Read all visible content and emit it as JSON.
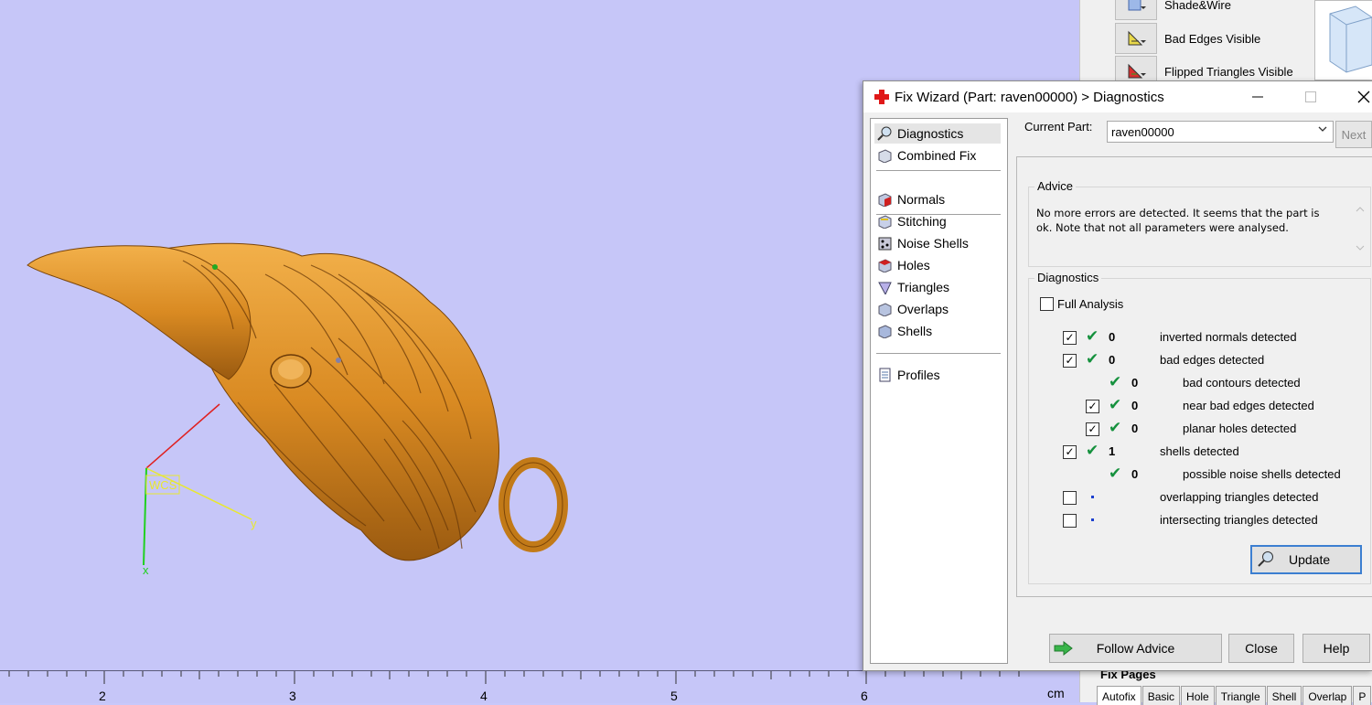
{
  "viewport": {
    "ruler_labels": [
      "2",
      "3",
      "4",
      "5",
      "6"
    ],
    "ruler_unit": "cm",
    "wcs_label": "WCS",
    "axis_x_label": "x",
    "axis_y_label": "y"
  },
  "right_panel": {
    "items": [
      {
        "label": "Shade&Wire"
      },
      {
        "label": "Bad Edges Visible"
      },
      {
        "label": "Flipped Triangles Visible"
      }
    ],
    "fix_pages_title": "Fix Pages",
    "fix_pages_tabs": [
      "Autofix",
      "Basic",
      "Hole",
      "Triangle",
      "Shell",
      "Overlap",
      "P"
    ]
  },
  "dialog": {
    "title": "Fix Wizard (Part: raven00000) > Diagnostics",
    "nav": {
      "items_top": [
        {
          "label": "Diagnostics",
          "icon": "magnifier-icon",
          "active": true
        },
        {
          "label": "Combined Fix",
          "icon": "cube-icon"
        }
      ],
      "items_mid": [
        {
          "label": "Normals",
          "icon": "normals-cube-icon"
        },
        {
          "label": "Stitching",
          "icon": "stitching-cube-icon"
        },
        {
          "label": "Noise Shells",
          "icon": "noise-shells-icon"
        },
        {
          "label": "Holes",
          "icon": "holes-cube-icon"
        },
        {
          "label": "Triangles",
          "icon": "triangles-icon"
        },
        {
          "label": "Overlaps",
          "icon": "overlaps-icon"
        },
        {
          "label": "Shells",
          "icon": "shells-icon"
        }
      ],
      "items_bottom": [
        {
          "label": "Profiles",
          "icon": "document-icon"
        }
      ]
    },
    "current_part_label": "Current Part:",
    "current_part_value": "raven00000",
    "next_label": "Next",
    "advice": {
      "title": "Advice",
      "text": "No more errors are detected. It seems that the part is ok. Note that not all parameters were analysed."
    },
    "diagnostics": {
      "title": "Diagnostics",
      "full_analysis_label": "Full Analysis",
      "full_analysis_checked": false,
      "rows": [
        {
          "checkbox": true,
          "checked": true,
          "status": "ok",
          "count": "0",
          "label": "inverted normals detected",
          "indent": 0
        },
        {
          "checkbox": true,
          "checked": true,
          "status": "ok",
          "count": "0",
          "label": "bad edges detected",
          "indent": 0
        },
        {
          "checkbox": false,
          "checked": false,
          "status": "ok",
          "count": "0",
          "label": "bad contours detected",
          "indent": 1
        },
        {
          "checkbox": true,
          "checked": true,
          "status": "ok",
          "count": "0",
          "label": "near bad edges detected",
          "indent": 1
        },
        {
          "checkbox": true,
          "checked": true,
          "status": "ok",
          "count": "0",
          "label": "planar holes detected",
          "indent": 1
        },
        {
          "checkbox": true,
          "checked": true,
          "status": "ok",
          "count": "1",
          "label": "shells detected",
          "indent": 0
        },
        {
          "checkbox": false,
          "checked": false,
          "status": "ok",
          "count": "0",
          "label": "possible noise shells detected",
          "indent": 1
        },
        {
          "checkbox": true,
          "checked": false,
          "status": "none",
          "count": "",
          "label": "overlapping triangles detected",
          "indent": 0
        },
        {
          "checkbox": true,
          "checked": false,
          "status": "none",
          "count": "",
          "label": "intersecting triangles detected",
          "indent": 0
        }
      ],
      "update_label": "Update"
    },
    "buttons": {
      "follow_advice": "Follow Advice",
      "close": "Close",
      "help": "Help"
    }
  },
  "colors": {
    "viewport_bg": "#c6c6f8",
    "model": "#d9891f",
    "check_green": "#15913d"
  }
}
